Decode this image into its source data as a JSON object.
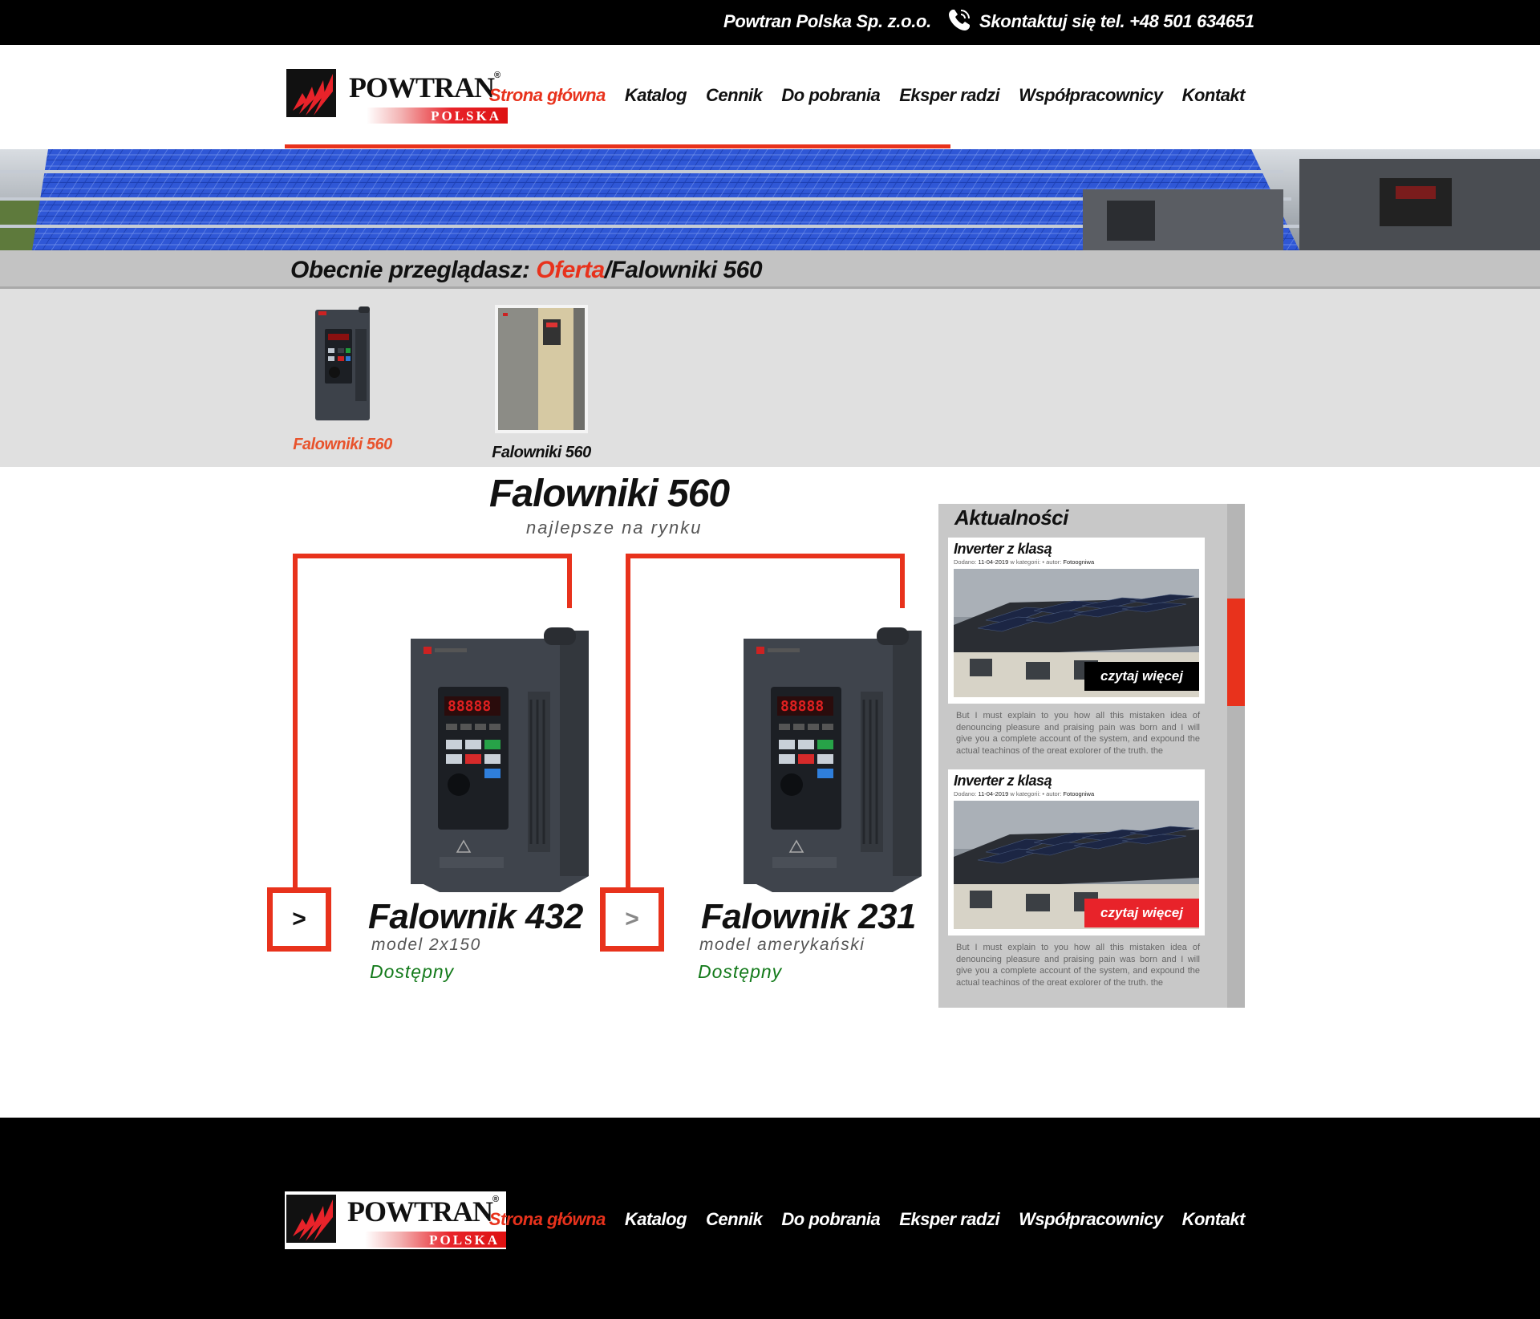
{
  "topbar": {
    "company": "Powtran Polska Sp. z.o.o.",
    "contact": "Skontaktuj się tel. +48 501 634651"
  },
  "logo": {
    "brand": "POWTRAN",
    "registered": "®",
    "sub": "POLSKA"
  },
  "nav": [
    {
      "label": "Strona główna",
      "active": true
    },
    {
      "label": "Katalog",
      "active": false
    },
    {
      "label": "Cennik",
      "active": false
    },
    {
      "label": "Do pobrania",
      "active": false
    },
    {
      "label": "Eksper radzi",
      "active": false
    },
    {
      "label": "Współpracownicy",
      "active": false
    },
    {
      "label": "Kontakt",
      "active": false
    }
  ],
  "breadcrumb": {
    "prefix": "Obecnie przeglądasz: ",
    "link": "Oferta",
    "separator": "/",
    "current": "Falowniki 560"
  },
  "categories": [
    {
      "label": "Falowniki 560",
      "active": true
    },
    {
      "label": "Falowniki 560",
      "active": false
    }
  ],
  "section": {
    "title": "Falowniki 560",
    "subtitle": "najlepsze na rynku"
  },
  "products": [
    {
      "arrow": ">",
      "name": "Falownik 432",
      "model": "model 2x150",
      "availability": "Dostępny"
    },
    {
      "arrow": ">",
      "name": "Falownik 231",
      "model": "model amerykański",
      "availability": "Dostępny"
    }
  ],
  "news": {
    "title": "Aktualności",
    "items": [
      {
        "title": "Inverter z klasą",
        "meta_added": "Dodano:",
        "date": "11-04-2019",
        "meta_category": "w kategorii:",
        "meta_author": "• autor:",
        "author": "Fotoogniwa",
        "more": "czytaj więcej",
        "excerpt": "But I must explain to you how all this mistaken idea of denouncing pleasure and praising pain was born and I will give you a complete account of the system, and expound the actual teachings of the great explorer of the truth, the"
      },
      {
        "title": "Inverter z klasą",
        "meta_added": "Dodano:",
        "date": "11-04-2019",
        "meta_category": "w kategorii:",
        "meta_author": "• autor:",
        "author": "Fotoogniwa",
        "more": "czytaj więcej",
        "excerpt": "But I must explain to you how all this mistaken idea of denouncing pleasure and praising pain was born and I will give you a complete account of the system, and expound the actual teachings of the great explorer of the truth, the"
      }
    ]
  },
  "colors": {
    "accent": "#e8321c",
    "available": "#137a1a",
    "more_button_1": "#000000",
    "more_button_2": "#e8232a"
  },
  "icons": {
    "phone": "phone-icon",
    "logo_mark": "powtran-logo-icon"
  }
}
